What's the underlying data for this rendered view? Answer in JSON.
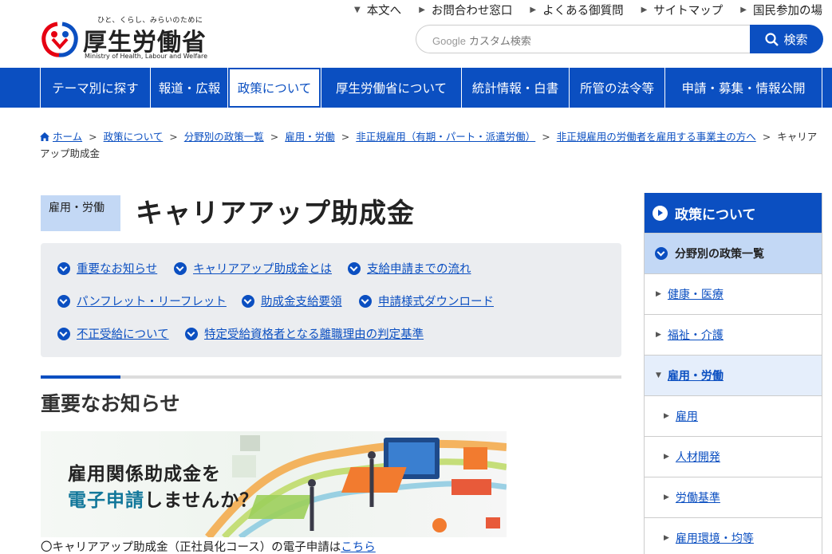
{
  "header": {
    "logo_tagline": "ひと、くらし、みらいのために",
    "logo_name": "厚生労働省",
    "logo_en": "Ministry of Health, Labour and Welfare",
    "utility_links": [
      {
        "label": "本文へ",
        "icon": "caret-down-icon"
      },
      {
        "label": "お問合わせ窓口",
        "icon": "chevron-right-icon"
      },
      {
        "label": "よくある御質問",
        "icon": "chevron-right-icon"
      },
      {
        "label": "サイトマップ",
        "icon": "chevron-right-icon"
      },
      {
        "label": "国民参加の場",
        "icon": "chevron-right-icon"
      }
    ],
    "search": {
      "placeholder_brand": "Google",
      "placeholder": "カスタム検索",
      "button_label": "検索",
      "icon": "search-icon"
    }
  },
  "gnav": {
    "items": [
      {
        "label": "テーマ別に探す",
        "active": false
      },
      {
        "label": "報道・広報",
        "active": false
      },
      {
        "label": "政策について",
        "active": true
      },
      {
        "label": "厚生労働省について",
        "active": false
      },
      {
        "label": "統計情報・白書",
        "active": false
      },
      {
        "label": "所管の法令等",
        "active": false
      },
      {
        "label": "申請・募集・情報公開",
        "active": false
      }
    ]
  },
  "breadcrumb": {
    "home_icon": "home-icon",
    "items": [
      "ホーム",
      "政策について",
      "分野別の政策一覧",
      "雇用・労働",
      "非正規雇用（有期・パート・派遣労働）",
      "非正規雇用の労働者を雇用する事業主の方へ"
    ],
    "current": "キャリアアップ助成金"
  },
  "main": {
    "category_badge": "雇用・労働",
    "title": "キャリアアップ助成金",
    "anchor_links": [
      "重要なお知らせ",
      "キャリアアップ助成金とは",
      "支給申請までの流れ",
      "パンフレット・リーフレット",
      "助成金支給要領",
      "申請様式ダウンロード",
      "不正受給について",
      "特定受給資格者となる離職理由の判定基準"
    ],
    "section_title": "重要なお知らせ",
    "banner": {
      "line1": "雇用関係助成金を",
      "line2_highlight": "電子申請",
      "line2_rest": "しませんか？"
    },
    "apply_text": "〇キャリアアップ助成金（正社員化コース）の電子申請は",
    "apply_link": "こちら"
  },
  "sidenav": {
    "heading": "政策について",
    "category": "分野別の政策一覧",
    "items": [
      {
        "label": "健康・医療",
        "level": 1
      },
      {
        "label": "福祉・介護",
        "level": 1
      },
      {
        "label": "雇用・労働",
        "level": 1,
        "open": true
      },
      {
        "label": "雇用",
        "level": 2
      },
      {
        "label": "人材開発",
        "level": 2
      },
      {
        "label": "労働基準",
        "level": 2
      },
      {
        "label": "雇用環境・均等",
        "level": 2
      }
    ]
  },
  "colors": {
    "brand_blue": "#0b4fc1",
    "light_blue": "#c3d8f5",
    "box_gray": "#ebedf0",
    "logo_red": "#e60012"
  }
}
